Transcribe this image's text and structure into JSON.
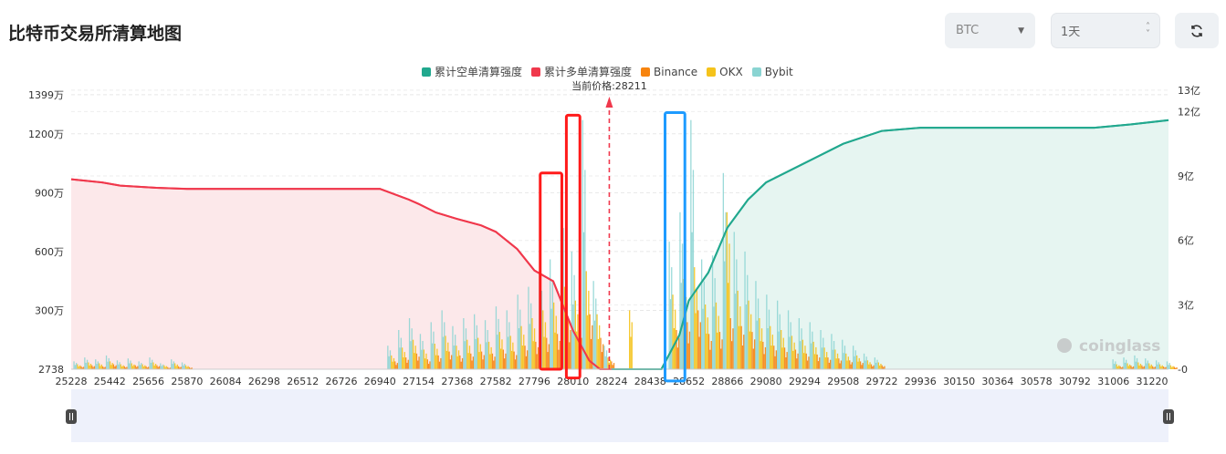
{
  "title": "比特币交易所清算地图",
  "controls": {
    "coin": "BTC",
    "range": "1天",
    "refresh_icon": "refresh-icon"
  },
  "watermark": "coinglass",
  "colors": {
    "short_cum": "#21a88e",
    "long_cum": "#f0384c",
    "binance": "#f7840f",
    "okx": "#f5c31b",
    "bybit": "#8ad4d2",
    "annot_red": "#ff1a1a",
    "annot_blue": "#1e9bff"
  },
  "chart_data": {
    "type": "bar",
    "current_price_label": "当前价格:28211",
    "current_price": 28211,
    "legend": [
      {
        "name": "累计空单清算强度",
        "color": "#21a88e"
      },
      {
        "name": "累计多单清算强度",
        "color": "#f0384c"
      },
      {
        "name": "Binance",
        "color": "#f7840f"
      },
      {
        "name": "OKX",
        "color": "#f5c31b"
      },
      {
        "name": "Bybit",
        "color": "#8ad4d2"
      }
    ],
    "x_ticks": [
      "25228",
      "25442",
      "25656",
      "25870",
      "26084",
      "26298",
      "26512",
      "26726",
      "26940",
      "27154",
      "27368",
      "27582",
      "27796",
      "28010",
      "28224",
      "28438",
      "28652",
      "28866",
      "29080",
      "29294",
      "29508",
      "29722",
      "29936",
      "30150",
      "30364",
      "30578",
      "30792",
      "31006",
      "31220"
    ],
    "xlim": [
      25228,
      31311
    ],
    "y_left_ticks": [
      "2738",
      "300万",
      "600万",
      "900万",
      "1200万",
      "1399万"
    ],
    "y_left_values": [
      0,
      300,
      600,
      900,
      1200,
      1399
    ],
    "y_right_ticks": [
      "0",
      "3亿",
      "6亿",
      "9亿",
      "12亿",
      "13亿"
    ],
    "y_right_values": [
      0,
      3,
      6,
      9,
      12,
      13
    ],
    "bin_start": 25240,
    "bin_step": 60,
    "bar_unit": "万",
    "series_bars": {
      "bybit": [
        40,
        60,
        50,
        70,
        45,
        55,
        40,
        60,
        30,
        50,
        35,
        0,
        0,
        0,
        0,
        0,
        0,
        0,
        0,
        0,
        0,
        0,
        0,
        0,
        0,
        0,
        0,
        0,
        0,
        120,
        200,
        260,
        180,
        240,
        300,
        220,
        260,
        280,
        250,
        320,
        300,
        380,
        420,
        500,
        560,
        900,
        600,
        1270,
        450,
        120,
        0,
        0,
        0,
        0,
        0,
        650,
        800,
        1270,
        560,
        580,
        1000,
        700,
        600,
        450,
        380,
        350,
        300,
        260,
        240,
        200,
        180,
        150,
        120,
        80,
        60,
        0,
        0,
        0,
        0,
        0,
        0,
        0,
        0,
        0,
        0,
        0,
        0,
        0,
        0,
        0,
        0,
        0,
        0,
        0,
        0,
        0,
        50,
        60,
        70,
        55,
        45,
        40
      ],
      "okx": [
        25,
        35,
        30,
        40,
        25,
        30,
        25,
        35,
        20,
        30,
        20,
        0,
        0,
        0,
        0,
        0,
        0,
        0,
        0,
        0,
        0,
        0,
        0,
        0,
        0,
        0,
        0,
        0,
        0,
        70,
        110,
        150,
        100,
        130,
        170,
        120,
        150,
        160,
        140,
        190,
        170,
        220,
        260,
        300,
        340,
        420,
        350,
        500,
        280,
        60,
        0,
        300,
        0,
        0,
        0,
        380,
        460,
        520,
        330,
        340,
        800,
        400,
        350,
        260,
        220,
        200,
        170,
        150,
        140,
        110,
        100,
        80,
        70,
        45,
        35,
        0,
        0,
        0,
        0,
        0,
        0,
        0,
        0,
        0,
        0,
        0,
        0,
        0,
        0,
        0,
        0,
        0,
        0,
        0,
        0,
        0,
        25,
        30,
        35,
        30,
        25,
        20
      ],
      "binance": [
        15,
        20,
        15,
        25,
        15,
        20,
        15,
        20,
        10,
        15,
        10,
        0,
        0,
        0,
        0,
        0,
        0,
        0,
        0,
        0,
        0,
        0,
        0,
        0,
        0,
        0,
        0,
        0,
        0,
        40,
        60,
        80,
        50,
        70,
        90,
        70,
        80,
        90,
        80,
        100,
        90,
        120,
        140,
        160,
        180,
        250,
        200,
        280,
        160,
        40,
        0,
        0,
        0,
        0,
        0,
        200,
        240,
        300,
        180,
        190,
        260,
        220,
        190,
        140,
        120,
        110,
        100,
        80,
        75,
        60,
        55,
        45,
        40,
        25,
        20,
        0,
        0,
        0,
        0,
        0,
        0,
        0,
        0,
        0,
        0,
        0,
        0,
        0,
        0,
        0,
        0,
        0,
        0,
        0,
        0,
        0,
        15,
        18,
        20,
        16,
        14,
        12
      ]
    },
    "long_cumulative_yi": [
      [
        25228,
        8.85
      ],
      [
        25400,
        8.7
      ],
      [
        25500,
        8.55
      ],
      [
        25700,
        8.45
      ],
      [
        25870,
        8.4
      ],
      [
        26940,
        8.4
      ],
      [
        27100,
        7.9
      ],
      [
        27154,
        7.7
      ],
      [
        27250,
        7.3
      ],
      [
        27368,
        7.0
      ],
      [
        27500,
        6.7
      ],
      [
        27582,
        6.4
      ],
      [
        27700,
        5.6
      ],
      [
        27796,
        4.6
      ],
      [
        27900,
        4.1
      ],
      [
        28010,
        1.8
      ],
      [
        28100,
        0.4
      ],
      [
        28160,
        0
      ],
      [
        28224,
        0
      ]
    ],
    "short_cumulative_yi": [
      [
        28224,
        0
      ],
      [
        28500,
        0
      ],
      [
        28600,
        1.6
      ],
      [
        28652,
        3.2
      ],
      [
        28760,
        4.5
      ],
      [
        28866,
        6.6
      ],
      [
        28980,
        7.9
      ],
      [
        29080,
        8.7
      ],
      [
        29294,
        9.6
      ],
      [
        29508,
        10.5
      ],
      [
        29722,
        11.1
      ],
      [
        29936,
        11.25
      ],
      [
        30150,
        11.25
      ],
      [
        30900,
        11.25
      ],
      [
        31100,
        11.4
      ],
      [
        31311,
        11.6
      ]
    ],
    "annotations": [
      {
        "color": "red",
        "price": [
          27828,
          27948
        ],
        "value_wan": [
          1000,
          0
        ]
      },
      {
        "color": "red",
        "price": [
          27973,
          28048
        ],
        "value_wan": [
          1295,
          -45
        ]
      },
      {
        "color": "blue",
        "price": [
          28520,
          28630
        ],
        "value_wan": [
          1308,
          -60
        ]
      }
    ]
  }
}
